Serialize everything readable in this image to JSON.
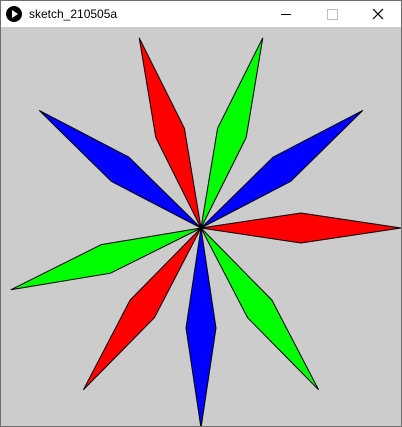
{
  "window": {
    "title": "sketch_210505a",
    "app_icon": "processing-play-icon",
    "controls": [
      "minimize-icon",
      "maximize-icon",
      "close-icon"
    ]
  },
  "sketch": {
    "background": "#cccccc",
    "stroke": "#000000",
    "petal_colors": [
      "#ff0000",
      "#00ff00",
      "#0000ff"
    ],
    "petals": [
      {
        "color": "#ff0000",
        "angle_deg": 0
      },
      {
        "color": "#0000ff",
        "angle_deg": -36
      },
      {
        "color": "#00ff00",
        "angle_deg": -72
      },
      {
        "color": "#ff0000",
        "angle_deg": -108
      },
      {
        "color": "#0000ff",
        "angle_deg": -144
      },
      {
        "color": "#00ff00",
        "angle_deg": 162
      },
      {
        "color": "#ff0000",
        "angle_deg": 126
      },
      {
        "color": "#0000ff",
        "angle_deg": 90
      },
      {
        "color": "#00ff00",
        "angle_deg": 54
      }
    ]
  }
}
